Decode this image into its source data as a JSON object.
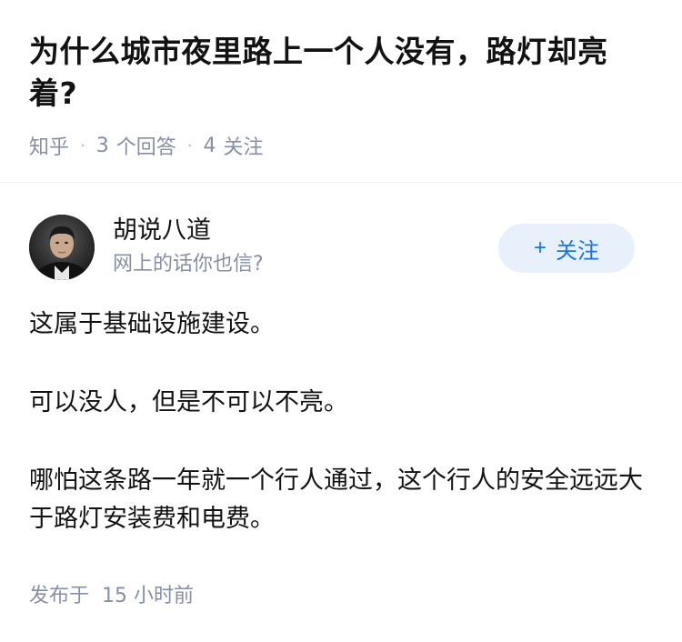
{
  "question": {
    "title": "为什么城市夜里路上一个人没有，路灯却亮着?",
    "source": "知乎",
    "answers_count": "3",
    "answers_label": "个回答",
    "followers_count": "4",
    "followers_label": "关注",
    "separator": "·"
  },
  "author": {
    "name": "胡说八道",
    "bio": "网上的话你也信?",
    "follow_plus": "+",
    "follow_label": "关注",
    "avatar_icon": "person-photo-avatar"
  },
  "answer": {
    "paragraphs": [
      "这属于基础设施建设。",
      "可以没人，但是不可以不亮。",
      "哪怕这条路一年就一个行人通过，这个行人的安全远远大于路灯安装费和电费。"
    ]
  },
  "footer": {
    "published_label": "发布于",
    "published_count": "15",
    "published_unit": "小时前"
  },
  "colors": {
    "accent": "#1772f6",
    "follow_bg": "#e8f1fb",
    "meta": "#8590a6",
    "text": "#121212"
  }
}
